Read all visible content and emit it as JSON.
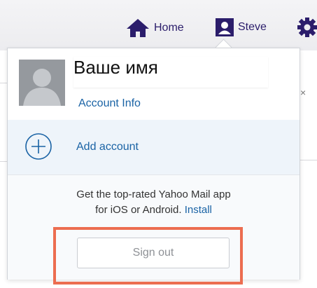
{
  "nav": {
    "home_label": "Home",
    "user_label": "Steve"
  },
  "dropdown": {
    "name": "Ваше имя",
    "account_info": "Account Info",
    "add_account": "Add account",
    "promo_line1": "Get the top-rated Yahoo Mail app",
    "promo_line2_text": "for iOS or Android. ",
    "promo_install": "Install",
    "sign_out": "Sign out",
    "close_glyph": "×"
  },
  "colors": {
    "brand": "#2b1d6b",
    "link": "#1a63a5",
    "highlight": "#ec6d50"
  }
}
